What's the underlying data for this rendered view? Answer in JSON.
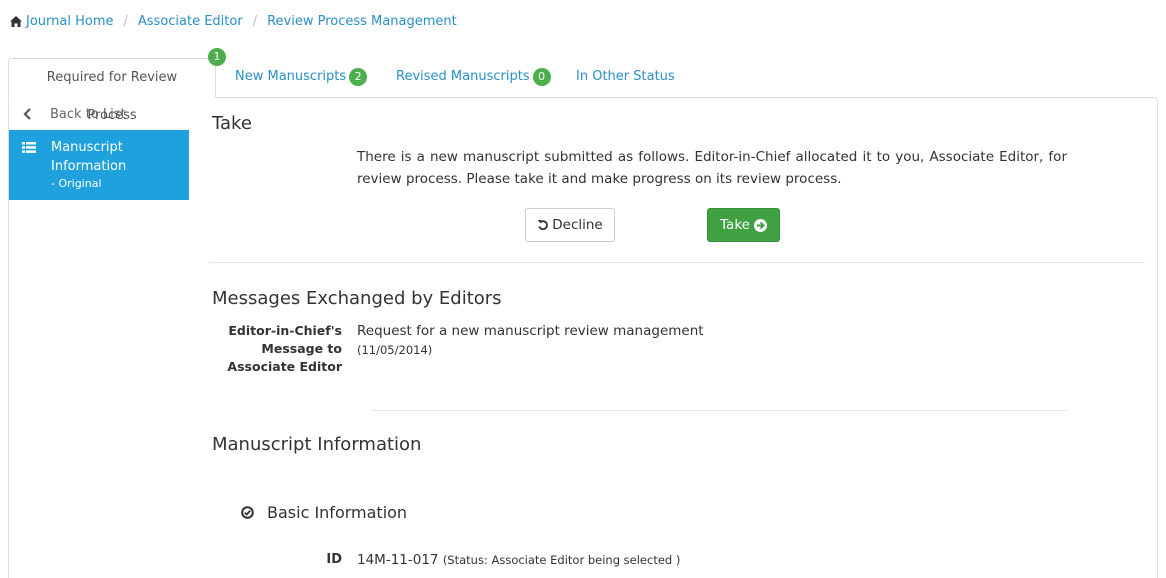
{
  "breadcrumb": {
    "items": [
      "Journal Home",
      "Associate Editor",
      "Review Process Management"
    ],
    "separator": "/"
  },
  "tabs": {
    "active": {
      "label": "Required for Review Process",
      "badge": "1"
    },
    "items": [
      {
        "label": "New Manuscripts",
        "badge": "2"
      },
      {
        "label": "Revised Manuscripts",
        "badge": "0"
      },
      {
        "label": "In Other Status"
      }
    ]
  },
  "sidebar": {
    "back_label": "Back to List",
    "active_label": "Manuscript Information",
    "active_sub": "- Original"
  },
  "take_section": {
    "title": "Take",
    "text": "There is a new manuscript submitted as follows. Editor-in-Chief allocated it to you, Associate Editor, for review process. Please take it and make progress on its review process.",
    "decline_label": "Decline",
    "take_label": "Take"
  },
  "messages": {
    "title": "Messages Exchanged by Editors",
    "label": "Editor-in-Chief's Message to Associate Editor",
    "text": "Request for a new manuscript review management",
    "date": "(11/05/2014)"
  },
  "manuscript_info": {
    "title": "Manuscript Information",
    "basic_label": "Basic Information",
    "id_label": "ID",
    "id_value": "14M-11-017",
    "id_status": "(Status: Associate Editor being selected )"
  },
  "colors": {
    "link": "#2a8fc7",
    "badge": "#4cae4c",
    "nav_active": "#1ea1dc",
    "take_button": "#3fa142"
  }
}
